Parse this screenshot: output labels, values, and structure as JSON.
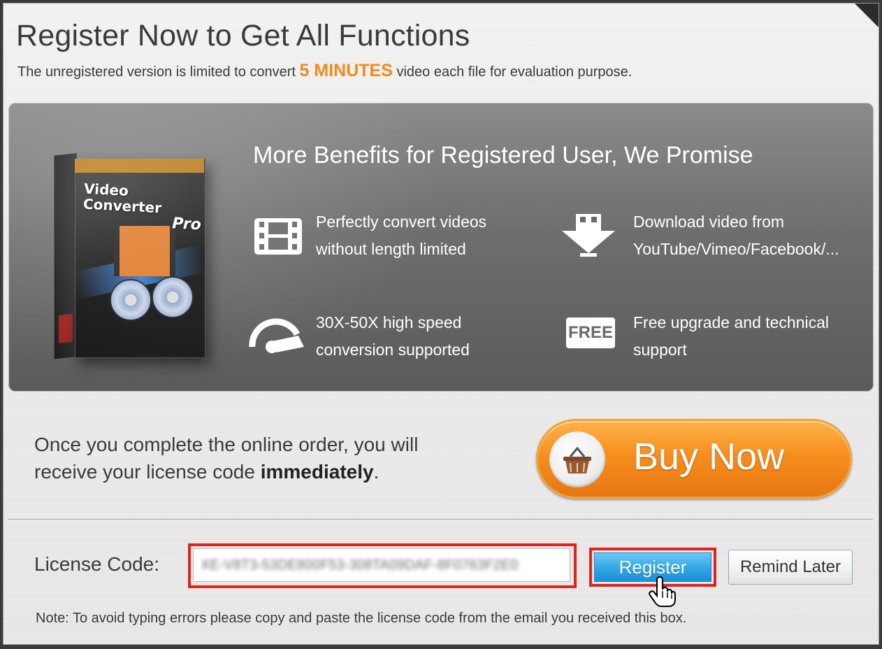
{
  "header": {
    "title": "Register Now to Get All Functions",
    "subtitle_before": "The unregistered version is limited to convert",
    "subtitle_highlight": "5 MINUTES",
    "subtitle_after": "video each file for evaluation purpose."
  },
  "product_box": {
    "name_line1": "Video Converter",
    "name_line2": "Pro"
  },
  "benefits": {
    "title": "More Benefits for Registered User, We Promise",
    "items": [
      {
        "icon": "film-icon",
        "line1": "Perfectly convert videos",
        "line2": "without length limited"
      },
      {
        "icon": "download-icon",
        "line1": "Download video from",
        "line2": "YouTube/Vimeo/Facebook/..."
      },
      {
        "icon": "speedometer-icon",
        "line1": "30X-50X high speed",
        "line2": "conversion supported"
      },
      {
        "icon": "free-badge-icon",
        "badge": "FREE",
        "line1": "Free upgrade and technical",
        "line2": "support"
      }
    ]
  },
  "order_info": {
    "line1": "Once you complete the online order, you will",
    "line2_before": "receive your license code",
    "line2_bold": "immediately",
    "line2_after": "."
  },
  "buy_button": {
    "label": "Buy Now",
    "icon": "basket-icon"
  },
  "license": {
    "label": "License Code:",
    "value": "XE-V8T3-53DE800F53-308TA09DAF-8F0763F2E0",
    "value_blurred": true
  },
  "buttons": {
    "register": "Register",
    "remind_later": "Remind Later"
  },
  "note": "Note: To avoid typing errors please copy and paste the license code from the email you received this box.",
  "colors": {
    "accent_orange": "#f08a1c",
    "register_blue": "#34a8e8",
    "highlight_red": "#e2231a"
  }
}
